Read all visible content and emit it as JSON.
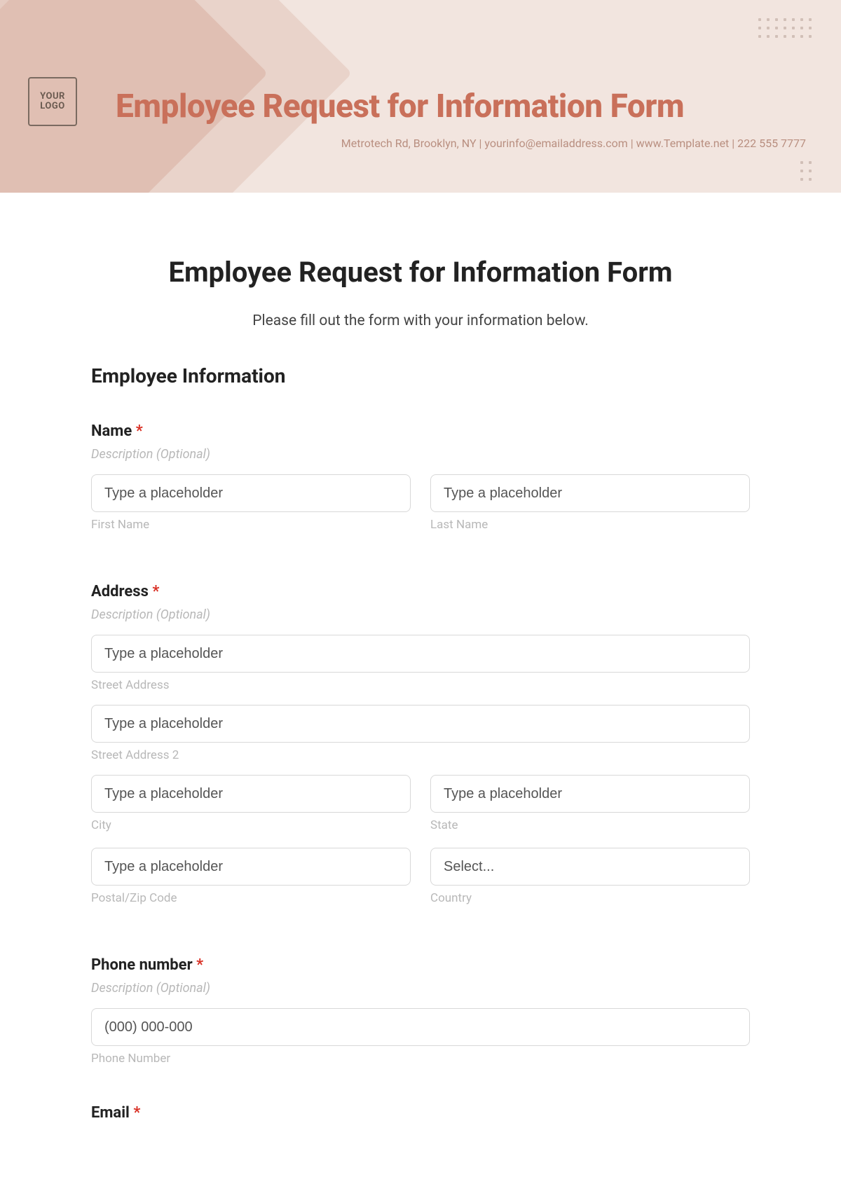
{
  "banner": {
    "logo_text": "YOUR LOGO",
    "title": "Employee Request for Information Form",
    "subline": "Metrotech Rd, Brooklyn, NY  |  yourinfo@emailaddress.com  |  www.Template.net  |  222 555 7777"
  },
  "form": {
    "title": "Employee Request for Information Form",
    "intro": "Please fill out the form with your information below.",
    "section_title": "Employee Information",
    "required_mark": "*",
    "desc_placeholder": "Description (Optional)",
    "generic_placeholder": "Type a placeholder",
    "name": {
      "label": "Name",
      "first_sub": "First Name",
      "last_sub": "Last Name"
    },
    "address": {
      "label": "Address",
      "street_sub": "Street Address",
      "street2_sub": "Street Address 2",
      "city_sub": "City",
      "state_sub": "State",
      "postal_sub": "Postal/Zip Code",
      "country_sub": "Country",
      "country_select_placeholder": "Select..."
    },
    "phone": {
      "label": "Phone number",
      "placeholder": "(000) 000-000",
      "sub": "Phone Number"
    },
    "email": {
      "label": "Email"
    }
  }
}
